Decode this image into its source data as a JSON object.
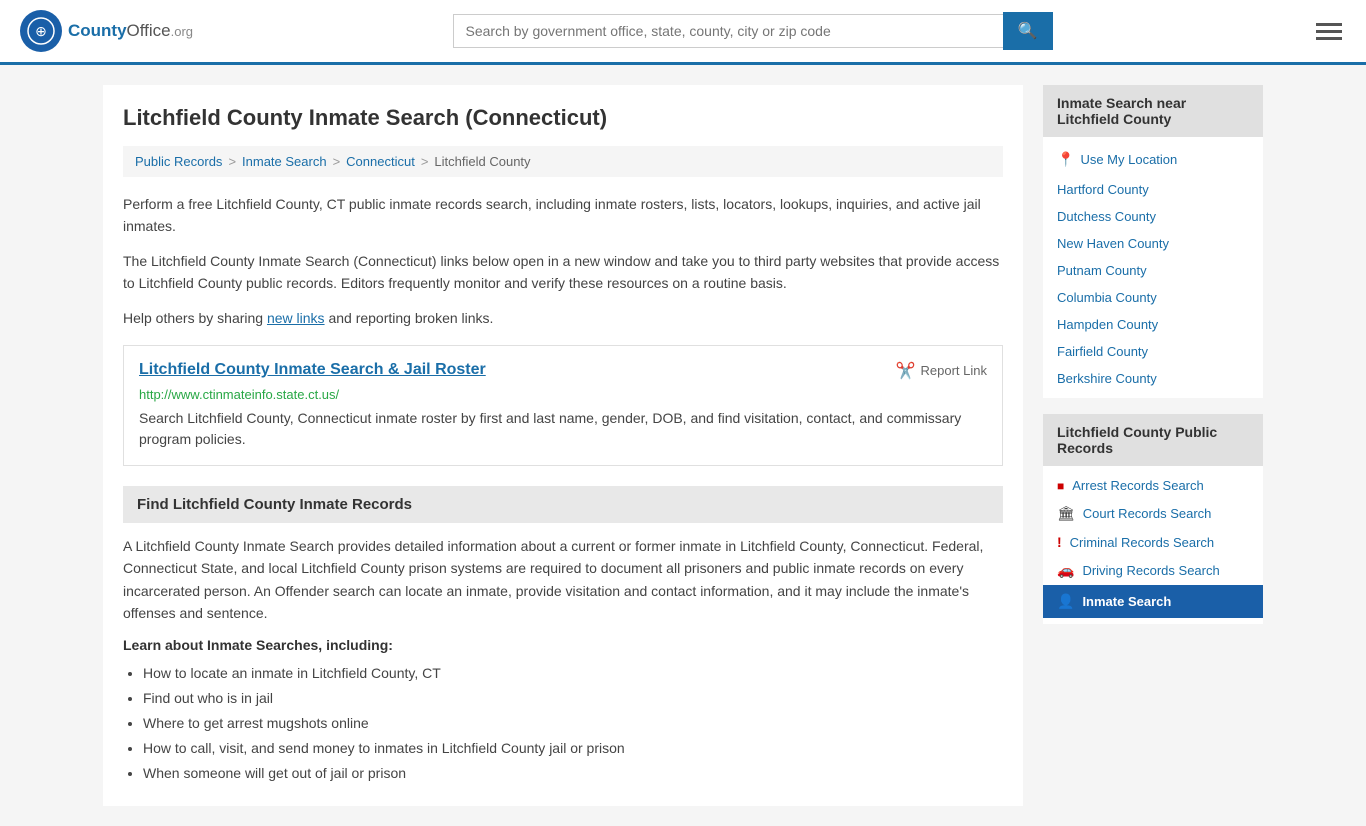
{
  "header": {
    "logo_text": "County",
    "logo_org": "Office.org",
    "search_placeholder": "Search by government office, state, county, city or zip code",
    "menu_label": "Menu"
  },
  "page": {
    "title": "Litchfield County Inmate Search (Connecticut)",
    "breadcrumbs": [
      {
        "label": "Public Records",
        "href": "#"
      },
      {
        "label": "Inmate Search",
        "href": "#"
      },
      {
        "label": "Connecticut",
        "href": "#"
      },
      {
        "label": "Litchfield County",
        "href": "#"
      }
    ],
    "intro_1": "Perform a free Litchfield County, CT public inmate records search, including inmate rosters, lists, locators, lookups, inquiries, and active jail inmates.",
    "intro_2": "The Litchfield County Inmate Search (Connecticut) links below open in a new window and take you to third party websites that provide access to Litchfield County public records. Editors frequently monitor and verify these resources on a routine basis.",
    "intro_3_pre": "Help others by sharing ",
    "new_links_text": "new links",
    "intro_3_post": " and reporting broken links.",
    "result": {
      "title": "Litchfield County Inmate Search & Jail Roster",
      "url": "http://www.ctinmateinfo.state.ct.us/",
      "description": "Search Litchfield County, Connecticut inmate roster by first and last name, gender, DOB, and find visitation, contact, and commissary program policies.",
      "report_label": "Report Link"
    },
    "find_records": {
      "heading": "Find Litchfield County Inmate Records",
      "text": "A Litchfield County Inmate Search provides detailed information about a current or former inmate in Litchfield County, Connecticut. Federal, Connecticut State, and local Litchfield County prison systems are required to document all prisoners and public inmate records on every incarcerated person. An Offender search can locate an inmate, provide visitation and contact information, and it may include the inmate's offenses and sentence.",
      "learn_heading": "Learn about Inmate Searches, including:",
      "bullets": [
        "How to locate an inmate in Litchfield County, CT",
        "Find out who is in jail",
        "Where to get arrest mugshots online",
        "How to call, visit, and send money to inmates in Litchfield County jail or prison",
        "When someone will get out of jail or prison"
      ]
    }
  },
  "sidebar": {
    "nearby_header": "Inmate Search near Litchfield County",
    "use_location": "Use My Location",
    "nearby_counties": [
      "Hartford County",
      "Dutchess County",
      "New Haven County",
      "Putnam County",
      "Columbia County",
      "Hampden County",
      "Fairfield County",
      "Berkshire County"
    ],
    "public_records_header": "Litchfield County Public Records",
    "public_records_links": [
      {
        "icon": "■",
        "label": "Arrest Records Search",
        "icon_class": "icon-arrest"
      },
      {
        "icon": "🏛",
        "label": "Court Records Search",
        "icon_class": "icon-court"
      },
      {
        "icon": "!",
        "label": "Criminal Records Search",
        "icon_class": "icon-criminal"
      },
      {
        "icon": "🚗",
        "label": "Driving Records Search",
        "icon_class": "icon-driving"
      }
    ],
    "inmate_search_bottom": "Inmate Search"
  }
}
